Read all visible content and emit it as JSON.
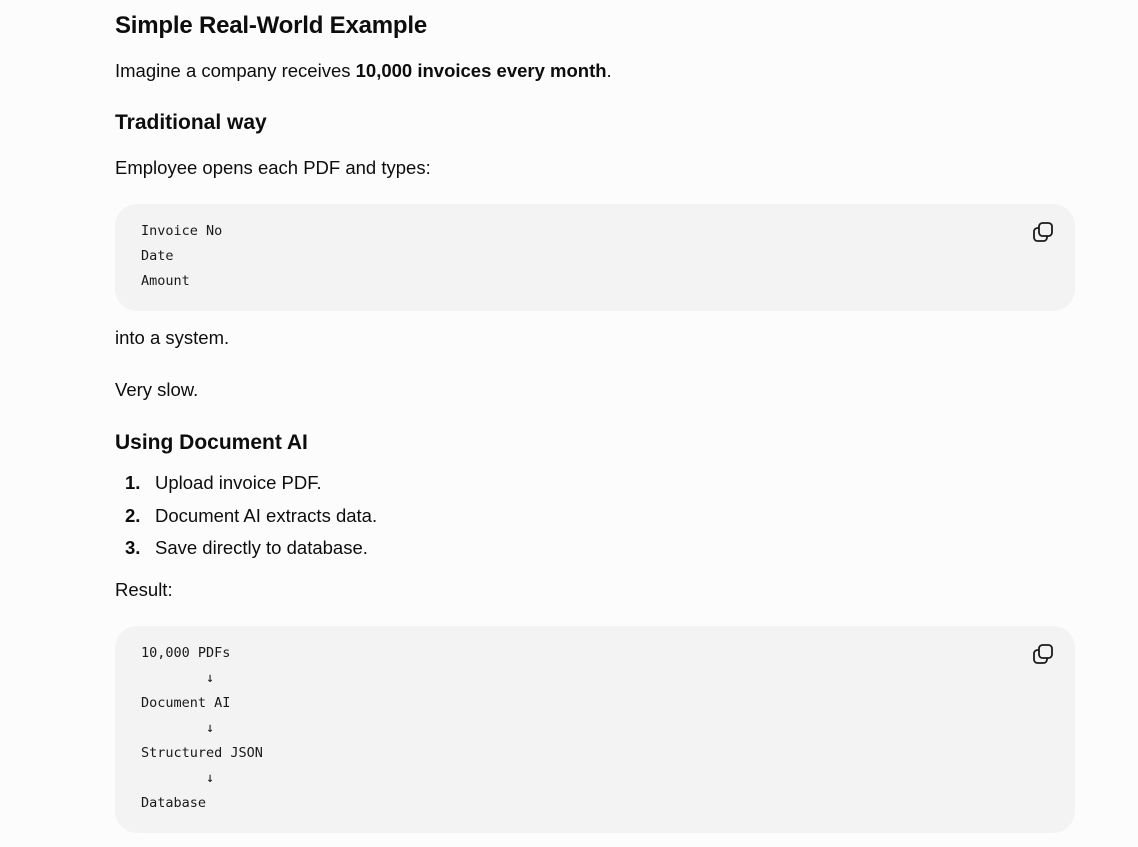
{
  "heading": "Simple Real-World Example",
  "intro": {
    "before": "Imagine a company receives ",
    "bold": "10,000 invoices every month",
    "after": "."
  },
  "traditional": {
    "heading": "Traditional way",
    "text": "Employee opens each PDF and types:",
    "code_lines": [
      "Invoice No",
      "Date",
      "Amount"
    ],
    "after_text": "into a system.",
    "comment": "Very slow."
  },
  "document_ai": {
    "heading": "Using Document AI",
    "steps": [
      {
        "num": "1.",
        "text": "Upload invoice PDF."
      },
      {
        "num": "2.",
        "text": "Document AI extracts data."
      },
      {
        "num": "3.",
        "text": "Save directly to database."
      }
    ],
    "result_label": "Result:",
    "code_lines": [
      "10,000 PDFs",
      "        ↓",
      "Document AI",
      "        ↓",
      "Structured JSON",
      "        ↓",
      "Database"
    ]
  },
  "icons": {
    "copy": "copy-icon"
  },
  "colors": {
    "background": "#fcfcfc",
    "code_background": "#f3f3f3",
    "text": "#0d0d0d"
  }
}
